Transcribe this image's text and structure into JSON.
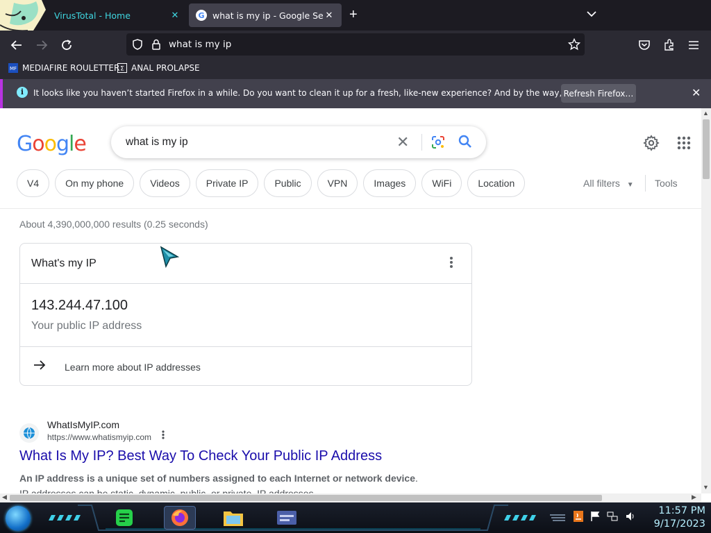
{
  "browser": {
    "tabs": [
      {
        "title": "VirusTotal - Home",
        "active": false
      },
      {
        "title": "what is my ip - Google Search",
        "active": true
      }
    ],
    "url": "what is my ip",
    "bookmarks": [
      {
        "label": "MEDIAFIRE ROULETTER"
      },
      {
        "label": "ANAL PROLAPSE"
      }
    ],
    "notification": {
      "message": "It looks like you haven’t started Firefox in a while. Do you want to clean it up for a fresh, like-new experience? And by the way, welcome back!",
      "button": "Refresh Firefox…"
    }
  },
  "google": {
    "logo": [
      "G",
      "o",
      "o",
      "g",
      "l",
      "e"
    ],
    "logo_colors": [
      "#4285f4",
      "#ea4335",
      "#fbbc05",
      "#4285f4",
      "#34a853",
      "#ea4335"
    ],
    "query": "what is my ip",
    "chips": [
      "V4",
      "On my phone",
      "Videos",
      "Private IP",
      "Public",
      "VPN",
      "Images",
      "WiFi",
      "Location"
    ],
    "all_filters": "All filters",
    "tools": "Tools",
    "stats": "About 4,390,000,000 results (0.25 seconds)",
    "ip_card": {
      "title": "What's my IP",
      "ip": "143.244.47.100",
      "subtitle": "Your public IP address",
      "learn_more": "Learn more about IP addresses"
    },
    "result": {
      "site_name": "WhatIsMyIP.com",
      "url": "https://www.whatismyip.com",
      "title": "What Is My IP? Best Way To Check Your Public IP Address",
      "snippet_bold": "An IP address is a unique set of numbers assigned to each Internet or network device",
      "snippet_rest": ". IP addresses can be static, dynamic, public, or private. IP addresses ..."
    }
  },
  "taskbar": {
    "time": "11:57 PM",
    "date": "9/17/2023"
  }
}
